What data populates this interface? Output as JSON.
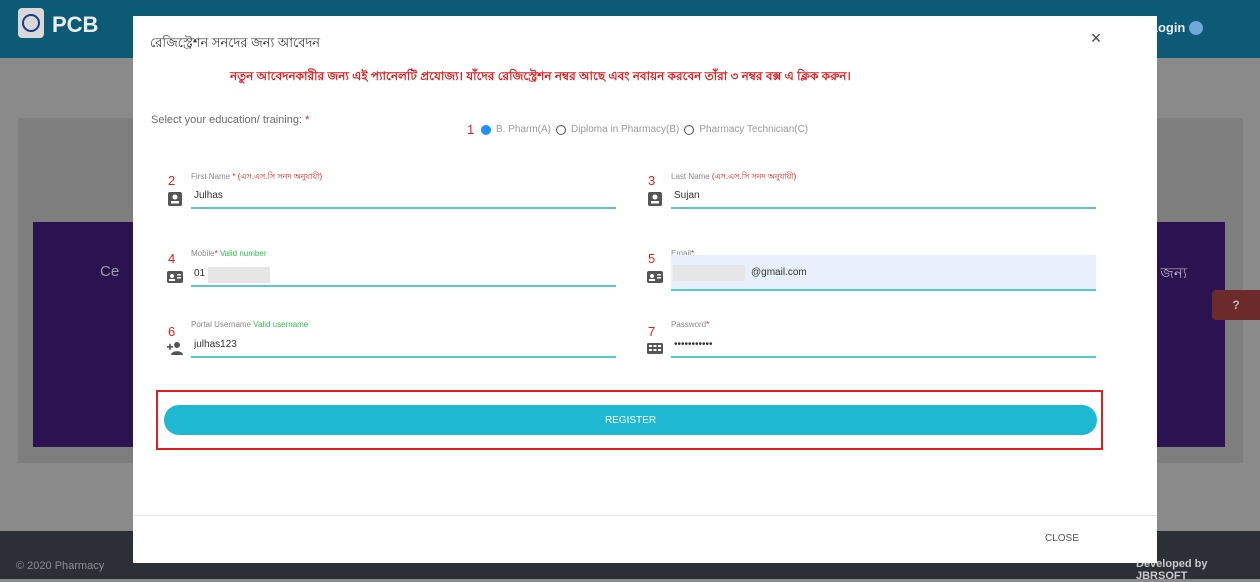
{
  "background": {
    "brand": "PCB",
    "login_label": "Login",
    "purple_text_left": "Ce",
    "purple_text_right": "র জন্য",
    "help_icon": "?",
    "footer_left": "© 2020 Pharmacy",
    "footer_right": "Developed by JBRSOFT"
  },
  "modal": {
    "title": "রেজিস্ট্রেশন সনদের জন্য আবেদন",
    "close_x": "×",
    "notice": "নতুন আবেদনকারীর জন্য এই প্যানেলটি প্রযোজ্য। যাঁদের রেজিস্ট্রেশন নম্বর আছে এবং নবায়ন করবেন তাঁরা ৩ নম্বর বক্স এ ক্লিক করুন।",
    "education_label": "Select your education/ training:",
    "required_mark": "*",
    "education_options": [
      {
        "label": "B. Pharm(A)",
        "selected": true
      },
      {
        "label": "Diploma in Pharmacy(B)",
        "selected": false
      },
      {
        "label": "Pharmacy Technician(C)",
        "selected": false
      }
    ],
    "step_numbers": [
      "1",
      "2",
      "3",
      "4",
      "5",
      "6",
      "7"
    ],
    "fields": {
      "first_name": {
        "label": "First Name",
        "hint": "(এস.এস.সি সনদ অনুযায়ী)",
        "value": "Julhas"
      },
      "last_name": {
        "label": "Last Name",
        "hint": "(এস.এস.সি সনদ অনুযায়ী)",
        "value": "Sujan"
      },
      "mobile": {
        "label": "Mobile",
        "valid": "Valid number",
        "value": "01"
      },
      "email": {
        "label": "Email",
        "value": "@gmail.com"
      },
      "username": {
        "label": "Portal Username",
        "valid": "Valid username",
        "value": "julhas123"
      },
      "password": {
        "label": "Password",
        "value": "•••••••••••"
      }
    },
    "register_label": "REGISTER",
    "close_label": "CLOSE"
  },
  "icons": {
    "name": "badge-icon",
    "contact": "contact-card-icon",
    "add_user": "add-person-icon",
    "password": "keypad-icon"
  },
  "colors": {
    "accent": "#1fb8d2",
    "underline": "#5bc7c7",
    "alert": "#e11d1d",
    "valid": "#2fbf4e"
  }
}
